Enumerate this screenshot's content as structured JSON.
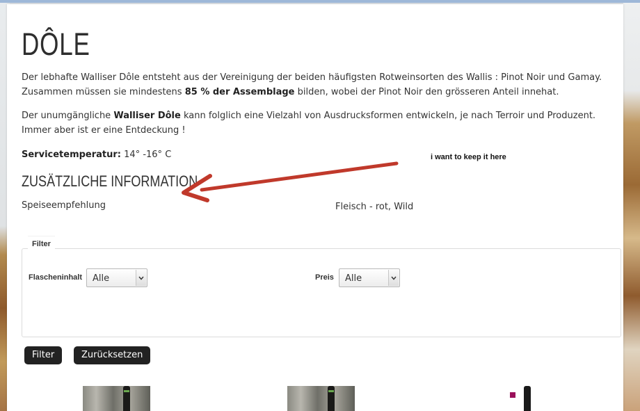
{
  "product": {
    "title": "DÔLE",
    "p1_a": "Der lebhafte Walliser Dôle entsteht aus der Vereinigung der beiden häufigsten Rotweinsorten des Wallis : Pinot Noir und Gamay. Zusammen müssen sie mindestens ",
    "p1_b": "85 % der Assemblage",
    "p1_c": " bilden, wobei der Pinot Noir den grösseren Anteil innehat.",
    "p2_a": "Der unumgängliche ",
    "p2_b": "Walliser Dôle",
    "p2_c": " kann folglich eine Vielzahl von Ausdrucksformen entwickeln, je nach Terroir und Produzent. Immer aber ist er eine Entdeckung !",
    "service_label": "Servicetemperatur:",
    "service_value": " 14° -16° C"
  },
  "additional_info": {
    "heading": "ZUSÄTZLICHE INFORMATION",
    "label": "Speiseempfehlung",
    "value": "Fleisch - rot, Wild"
  },
  "annotation": {
    "note": "i want to keep it here",
    "arrow_color": "#c0392b"
  },
  "filter": {
    "legend": "Filter",
    "fields": [
      {
        "label": "Flascheninhalt",
        "selected": "Alle"
      },
      {
        "label": "Preis",
        "selected": "Alle"
      }
    ],
    "filter_button": "Filter",
    "reset_button": "Zurücksetzen"
  },
  "colors": {
    "button_bg": "#222222",
    "accent_square": "#9a0f5a"
  }
}
